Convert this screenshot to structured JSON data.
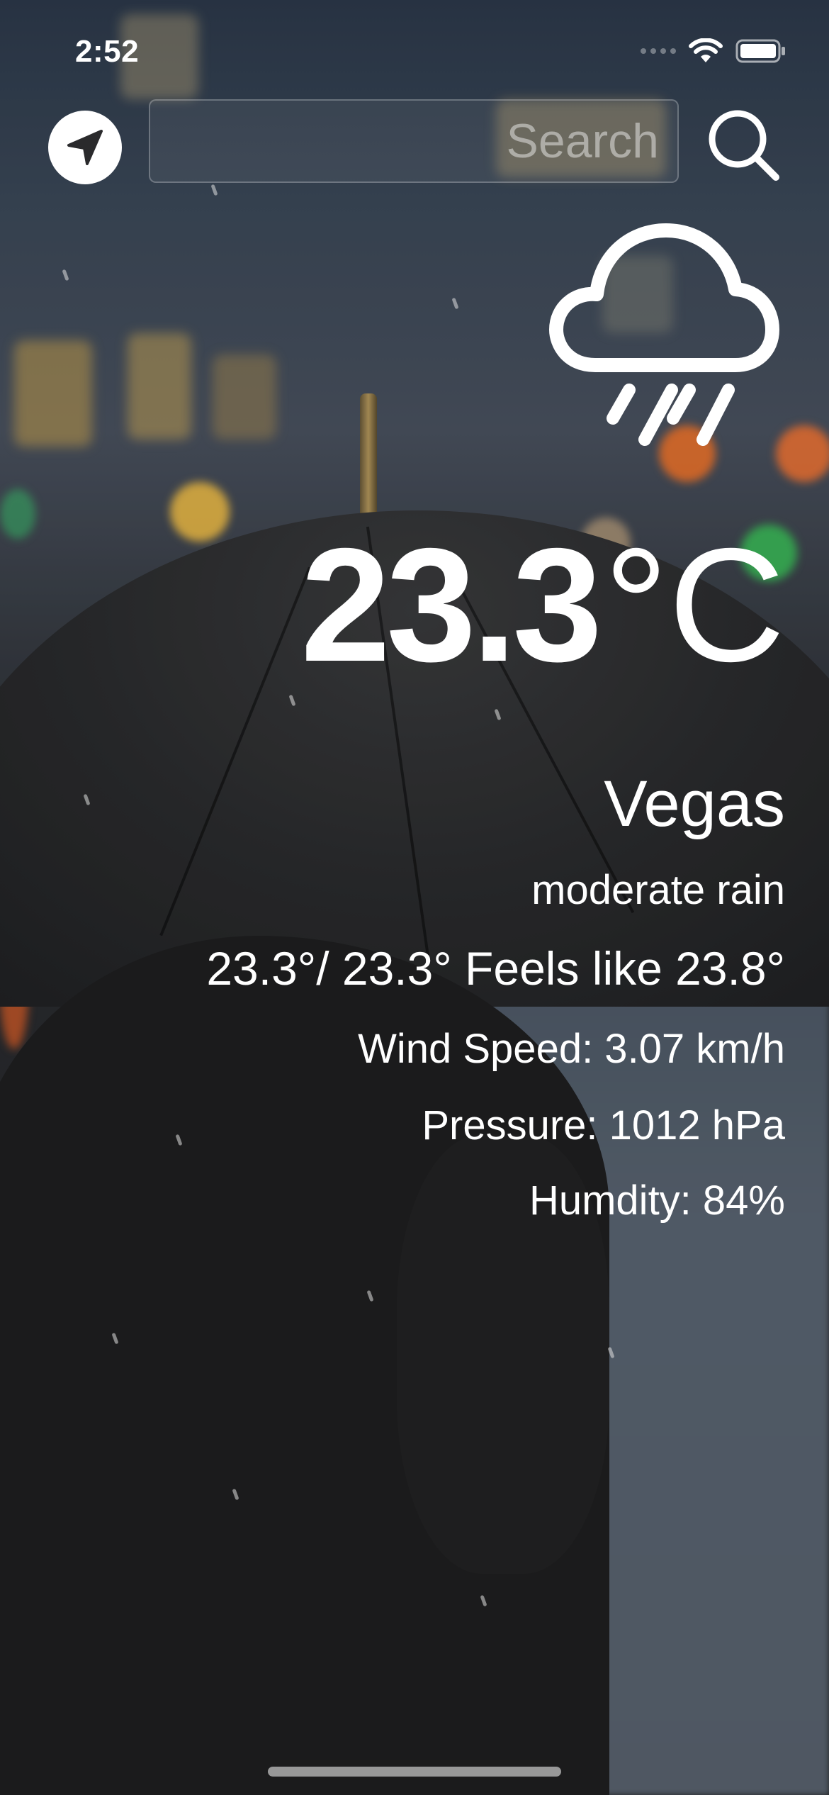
{
  "status_bar": {
    "time": "2:52",
    "icons": [
      "cellular-signal-icon",
      "wifi-icon",
      "battery-icon"
    ]
  },
  "header": {
    "location_icon": "location-arrow-icon",
    "search_placeholder": "Search",
    "search_value": "",
    "search_icon": "magnifier-icon"
  },
  "weather": {
    "condition_icon": "cloud-rain-icon",
    "temperature": "23.3",
    "unit": "°C",
    "city": "Vegas",
    "description": "moderate rain",
    "range_line": "23.3°/ 23.3° Feels like 23.8°",
    "wind_line": "Wind Speed: 3.07 km/h",
    "pressure_line": "Pressure: 1012 hPa",
    "humidity_line": "Humdity: 84%"
  },
  "colors": {
    "text": "#ffffff",
    "location_button_bg": "#ffffff",
    "location_arrow": "#2a2a2c"
  }
}
